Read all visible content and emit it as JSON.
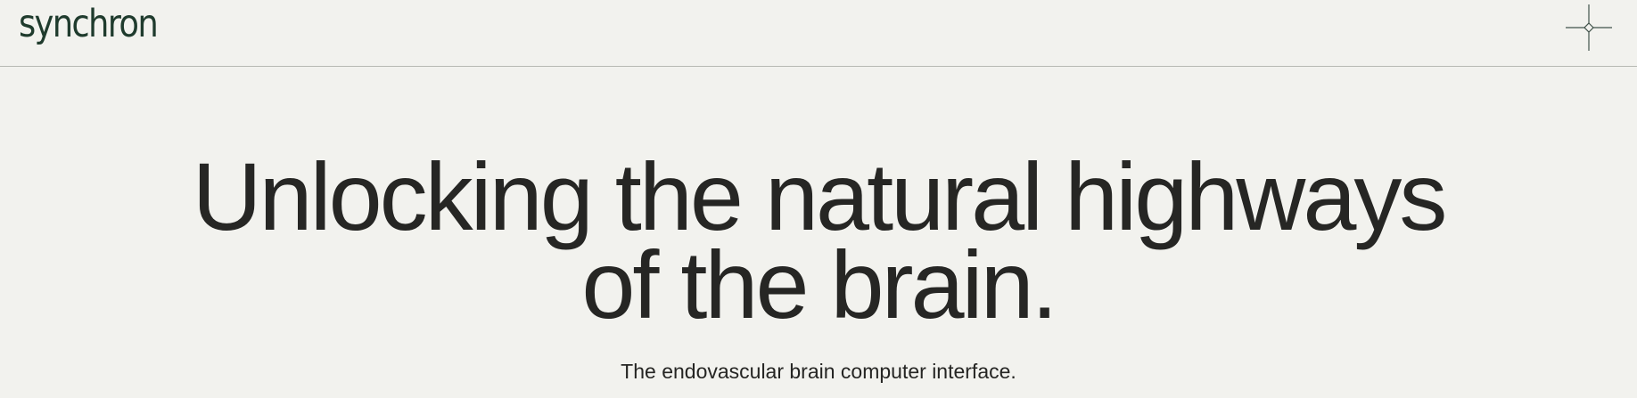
{
  "header": {
    "logo_text": "synchron",
    "menu_icon": "crosshair-menu-icon"
  },
  "hero": {
    "headline_line1": "Unlocking the natural highways",
    "headline_line2": "of the brain.",
    "subtitle": "The endovascular brain computer interface."
  },
  "colors": {
    "background": "#f2f2ee",
    "logo": "#1f3b2d",
    "text": "#252523",
    "divider": "#b6b8b2"
  }
}
